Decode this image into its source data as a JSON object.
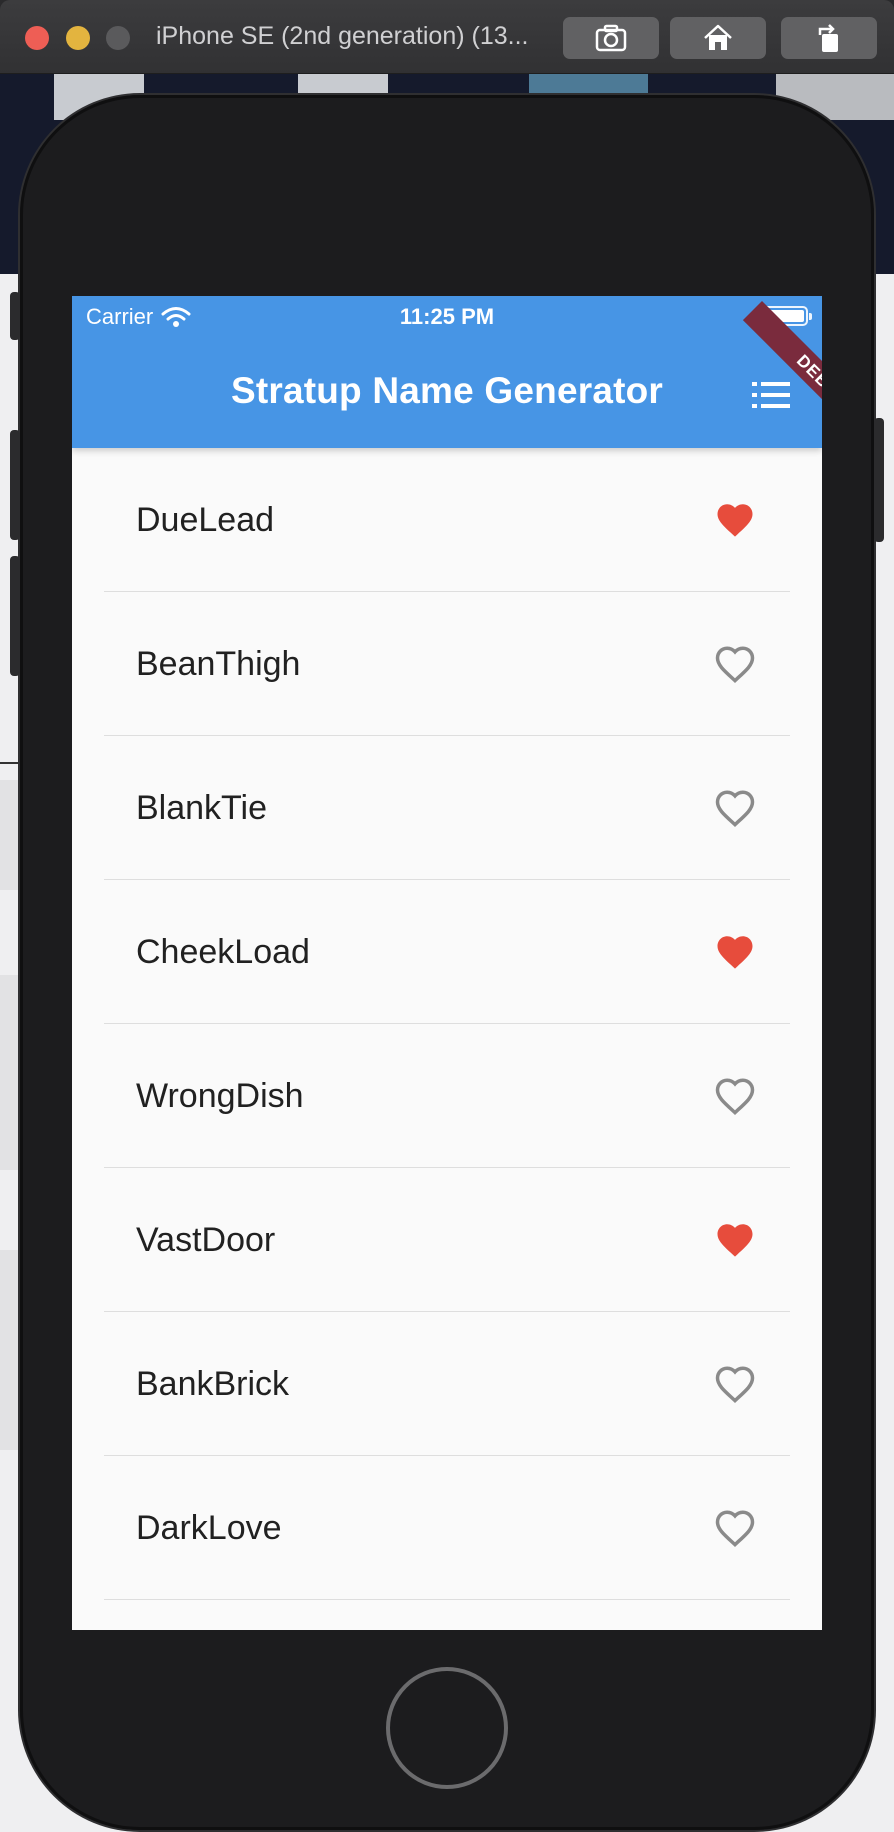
{
  "window": {
    "title": "iPhone SE (2nd generation) (13...",
    "buttons": [
      {
        "icon": "camera-icon"
      },
      {
        "icon": "home-icon"
      },
      {
        "icon": "rotate-icon"
      }
    ]
  },
  "status_bar": {
    "carrier": "Carrier",
    "time": "11:25 PM"
  },
  "app_bar": {
    "title": "Stratup Name Generator",
    "action_icon": "list-icon",
    "debug_banner": "DEBUG",
    "color": "#4795e5"
  },
  "list": {
    "items": [
      {
        "name": "DueLead",
        "saved": true
      },
      {
        "name": "BeanThigh",
        "saved": false
      },
      {
        "name": "BlankTie",
        "saved": false
      },
      {
        "name": "CheekLoad",
        "saved": true
      },
      {
        "name": "WrongDish",
        "saved": false
      },
      {
        "name": "VastDoor",
        "saved": true
      },
      {
        "name": "BankBrick",
        "saved": false
      },
      {
        "name": "DarkLove",
        "saved": false
      }
    ],
    "saved_color": "#e74c3c",
    "unsaved_color": "#8a8a8a"
  }
}
